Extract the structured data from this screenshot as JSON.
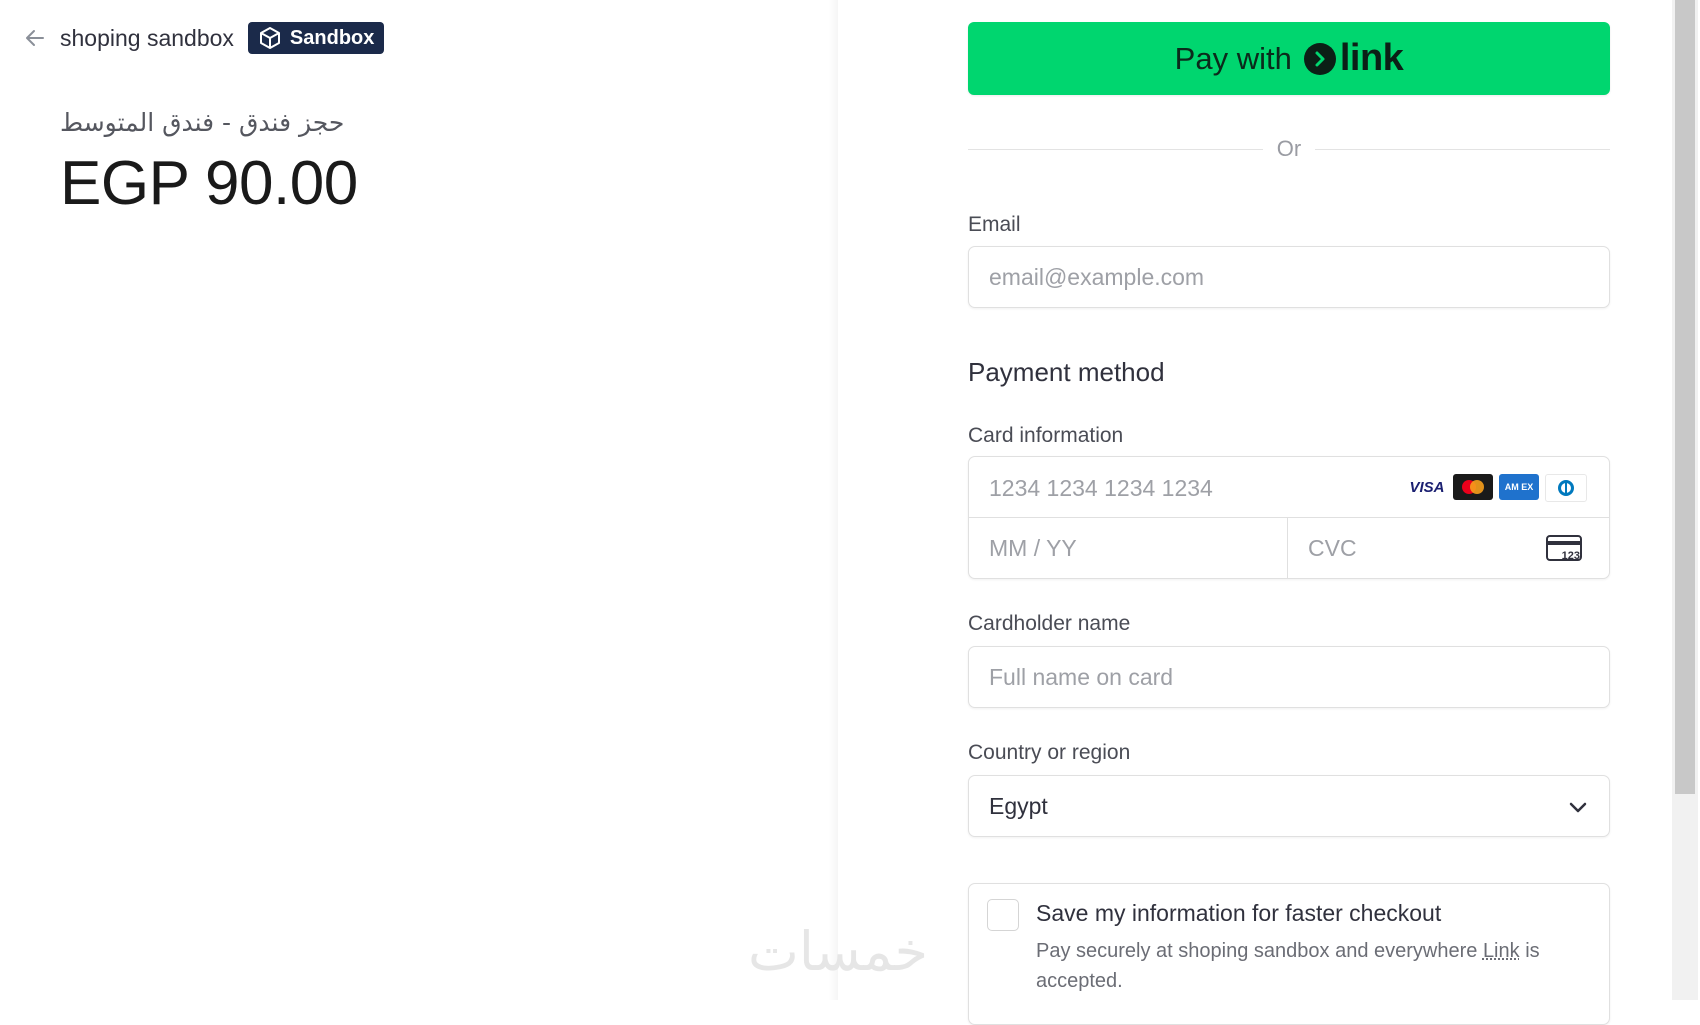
{
  "header": {
    "merchant_name": "shoping sandbox",
    "badge_label": "Sandbox"
  },
  "summary": {
    "product_name": "حجز فندق - فندق المتوسط",
    "price": "EGP 90.00"
  },
  "watermark": "خمسات",
  "link_button": {
    "prefix": "Pay with",
    "brand": "link",
    "color": "#00d66f"
  },
  "divider": {
    "text": "Or"
  },
  "email": {
    "label": "Email",
    "placeholder": "email@example.com",
    "value": ""
  },
  "payment": {
    "title": "Payment method",
    "card_label": "Card information",
    "card_number_placeholder": "1234 1234 1234 1234",
    "expiry_placeholder": "MM / YY",
    "cvc_placeholder": "CVC",
    "brands": [
      "visa-icon",
      "mastercard-icon",
      "amex-icon",
      "diners-icon"
    ],
    "brand_labels": {
      "visa": "VISA",
      "amex": "AM EX"
    },
    "cvc_icon_text": "123"
  },
  "cardholder": {
    "label": "Cardholder name",
    "placeholder": "Full name on card"
  },
  "country": {
    "label": "Country or region",
    "selected": "Egypt"
  },
  "save_info": {
    "checked": false,
    "title": "Save my information for faster checkout",
    "description_prefix": "Pay securely at shoping sandbox and everywhere ",
    "description_link": "Link",
    "description_suffix": " is accepted."
  }
}
